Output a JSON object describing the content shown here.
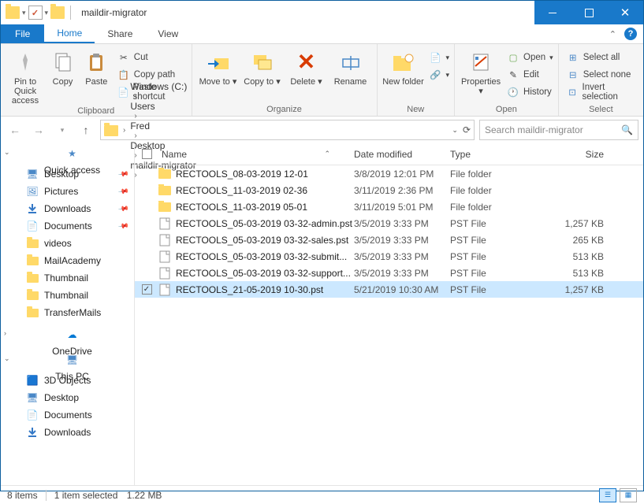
{
  "window": {
    "title": "maildir-migrator"
  },
  "tabs": {
    "file": "File",
    "home": "Home",
    "share": "Share",
    "view": "View"
  },
  "ribbon": {
    "clipboard": {
      "label": "Clipboard",
      "pin": "Pin to Quick access",
      "copy": "Copy",
      "paste": "Paste",
      "cut": "Cut",
      "copypath": "Copy path",
      "shortcut": "Paste shortcut"
    },
    "organize": {
      "label": "Organize",
      "moveto": "Move to",
      "copyto": "Copy to",
      "delete": "Delete",
      "rename": "Rename"
    },
    "new": {
      "label": "New",
      "folder": "New folder"
    },
    "open": {
      "label": "Open",
      "properties": "Properties",
      "open": "Open",
      "edit": "Edit",
      "history": "History"
    },
    "select": {
      "label": "Select",
      "all": "Select all",
      "none": "Select none",
      "invert": "Invert selection"
    }
  },
  "breadcrumb": [
    "Windows (C:)",
    "Users",
    "Fred",
    "Desktop",
    "maildir-migrator"
  ],
  "search": {
    "placeholder": "Search maildir-migrator"
  },
  "columns": {
    "name": "Name",
    "date": "Date modified",
    "type": "Type",
    "size": "Size"
  },
  "nav": {
    "quick": "Quick access",
    "items": [
      {
        "label": "Desktop",
        "pinned": true,
        "icon": "desktop"
      },
      {
        "label": "Pictures",
        "pinned": true,
        "icon": "pictures"
      },
      {
        "label": "Downloads",
        "pinned": true,
        "icon": "downloads"
      },
      {
        "label": "Documents",
        "pinned": true,
        "icon": "documents"
      },
      {
        "label": "videos",
        "pinned": false,
        "icon": "folder"
      },
      {
        "label": "MailAcademy",
        "pinned": false,
        "icon": "folder"
      },
      {
        "label": "Thumbnail",
        "pinned": false,
        "icon": "folder"
      },
      {
        "label": "Thumbnail",
        "pinned": false,
        "icon": "folder"
      },
      {
        "label": "TransferMails",
        "pinned": false,
        "icon": "folder"
      }
    ],
    "onedrive": "OneDrive",
    "thispc": "This PC",
    "pcitems": [
      {
        "label": "3D Objects",
        "icon": "3d"
      },
      {
        "label": "Desktop",
        "icon": "desktop"
      },
      {
        "label": "Documents",
        "icon": "documents"
      },
      {
        "label": "Downloads",
        "icon": "downloads"
      }
    ]
  },
  "files": [
    {
      "name": "RECTOOLS_08-03-2019 12-01",
      "date": "3/8/2019 12:01 PM",
      "type": "File folder",
      "size": "",
      "icon": "folder",
      "selected": false
    },
    {
      "name": "RECTOOLS_11-03-2019 02-36",
      "date": "3/11/2019 2:36 PM",
      "type": "File folder",
      "size": "",
      "icon": "folder",
      "selected": false
    },
    {
      "name": "RECTOOLS_11-03-2019 05-01",
      "date": "3/11/2019 5:01 PM",
      "type": "File folder",
      "size": "",
      "icon": "folder",
      "selected": false
    },
    {
      "name": "RECTOOLS_05-03-2019 03-32-admin.pst",
      "date": "3/5/2019 3:33 PM",
      "type": "PST File",
      "size": "1,257 KB",
      "icon": "file",
      "selected": false
    },
    {
      "name": "RECTOOLS_05-03-2019 03-32-sales.pst",
      "date": "3/5/2019 3:33 PM",
      "type": "PST File",
      "size": "265 KB",
      "icon": "file",
      "selected": false
    },
    {
      "name": "RECTOOLS_05-03-2019 03-32-submit...",
      "date": "3/5/2019 3:33 PM",
      "type": "PST File",
      "size": "513 KB",
      "icon": "file",
      "selected": false
    },
    {
      "name": "RECTOOLS_05-03-2019 03-32-support...",
      "date": "3/5/2019 3:33 PM",
      "type": "PST File",
      "size": "513 KB",
      "icon": "file",
      "selected": false
    },
    {
      "name": "RECTOOLS_21-05-2019 10-30.pst",
      "date": "5/21/2019 10:30 AM",
      "type": "PST File",
      "size": "1,257 KB",
      "icon": "file",
      "selected": true
    }
  ],
  "status": {
    "count": "8 items",
    "selected": "1 item selected",
    "size": "1.22 MB"
  }
}
